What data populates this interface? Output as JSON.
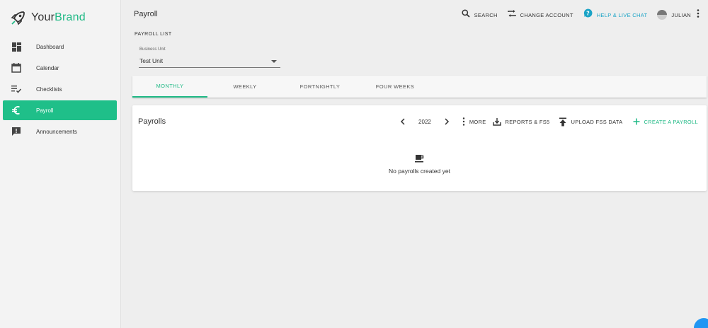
{
  "brand": {
    "name_part1": "Your",
    "name_part2": "Brand",
    "logo_icon": "rocket-icon",
    "accent_color": "#1fb985"
  },
  "sidebar": {
    "items": [
      {
        "label": "Dashboard",
        "icon": "dashboard-icon",
        "active": false
      },
      {
        "label": "Calendar",
        "icon": "calendar-icon",
        "active": false
      },
      {
        "label": "Checklists",
        "icon": "checklist-icon",
        "active": false
      },
      {
        "label": "Payroll",
        "icon": "euro-icon",
        "active": true
      },
      {
        "label": "Announcements",
        "icon": "announcement-icon",
        "active": false
      }
    ]
  },
  "header": {
    "title": "Payroll",
    "search_label": "SEARCH",
    "change_account_label": "CHANGE ACCOUNT",
    "help_label": "HELP & LIVE CHAT",
    "user_name": "JULIAN",
    "help_color": "#1aa3c6"
  },
  "payroll_list": {
    "section_label": "PAYROLL LIST",
    "business_unit_label": "Business Unit",
    "business_unit_value": "Test Unit"
  },
  "tabs": [
    {
      "label": "MONTHLY",
      "active": true
    },
    {
      "label": "WEEKLY",
      "active": false
    },
    {
      "label": "FORTNIGHTLY",
      "active": false
    },
    {
      "label": "FOUR WEEKS",
      "active": false
    }
  ],
  "card": {
    "title": "Payrolls",
    "year": "2022",
    "more_label": "MORE",
    "reports_label": "REPORTS & FS5",
    "upload_label": "UPLOAD FSS DATA",
    "create_label": "CREATE A PAYROLL",
    "empty_text": "No payrolls created yet",
    "empty_icon": "coffee-icon"
  }
}
